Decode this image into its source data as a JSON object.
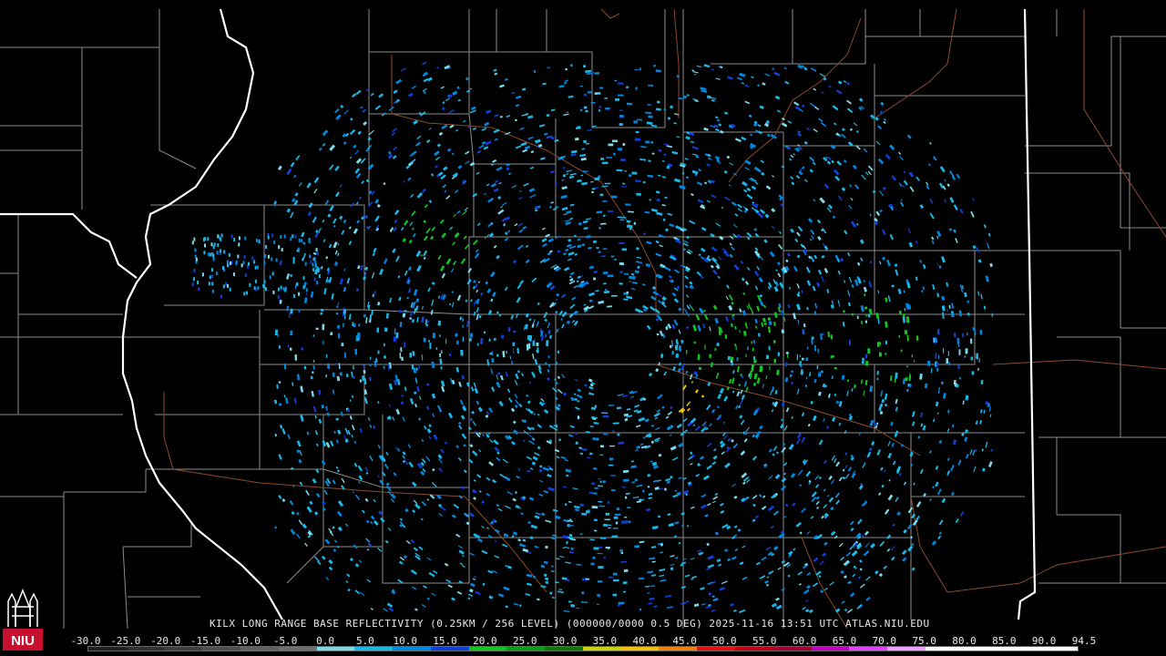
{
  "caption": {
    "text": "KILX LONG RANGE BASE REFLECTIVITY (0.25KM / 256 LEVEL) (000000/0000 0.5 DEG) 2025-11-16 13:51 UTC  ATLAS.NIU.EDU"
  },
  "logo": {
    "text": "NIU",
    "color": "#c8102e"
  },
  "legend": {
    "labels": [
      "-30.0",
      "-25.0",
      "-20.0",
      "-15.0",
      "-10.0",
      "-5.0",
      "0.0",
      "5.0",
      "10.0",
      "15.0",
      "20.0",
      "25.0",
      "30.0",
      "35.0",
      "40.0",
      "45.0",
      "50.0",
      "55.0",
      "60.0",
      "65.0",
      "70.0",
      "75.0",
      "80.0",
      "85.0",
      "90.0",
      "94.5"
    ],
    "colors": [
      "#202020",
      "#303030",
      "#404040",
      "#505050",
      "#606060",
      "#707070",
      "#7fd9e8",
      "#19b8e8",
      "#0088e0",
      "#1040d8",
      "#10c820",
      "#08a010",
      "#0a7a0a",
      "#c8d010",
      "#f0c010",
      "#f08010",
      "#e81010",
      "#c00010",
      "#a00030",
      "#c000c0",
      "#e040ff",
      "#f0a0ff",
      "#ffffff",
      "#ffffff",
      "#ffffff",
      "#ffffff"
    ]
  },
  "map": {
    "state_border_color": "#ffffff",
    "county_border_color": "#9a9a9a",
    "highway_color": "#a0522d"
  }
}
